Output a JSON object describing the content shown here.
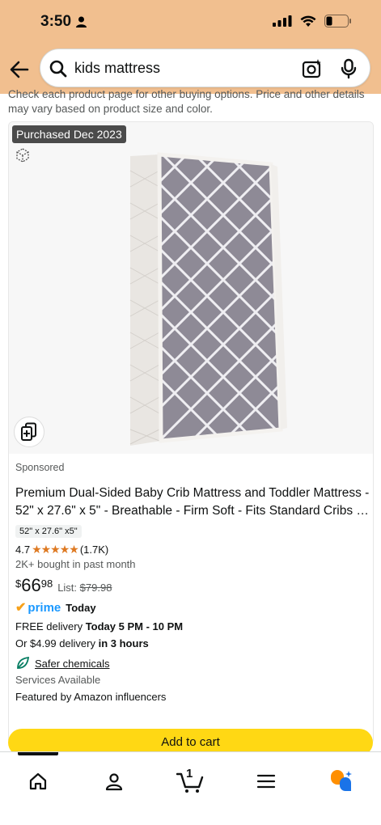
{
  "status_bar": {
    "time": "3:50"
  },
  "search": {
    "query": "kids mattress"
  },
  "disclaimer": "Check each product page for other buying options. Price and other details may vary based on product size and color.",
  "product": {
    "badge": "Purchased Dec 2023",
    "sponsored": "Sponsored",
    "title_line1": "Premium Dual-Sided Baby Crib Mattress and Toddler Mattress -",
    "title_line2": "52\" x 27.6\" x 5\" - Breathable - Firm Soft - Fits Standard Cribs and...",
    "size_chip": "52\" x 27.6\" x5\"",
    "rating": "4.7",
    "stars": "★★★★★",
    "review_count": "(1.7K)",
    "bought": "2K+ bought in past month",
    "price_currency": "$",
    "price_whole": "66",
    "price_fraction": "98",
    "list_label": "List:",
    "list_price": "$79.98",
    "prime_label": "prime",
    "prime_today": "Today",
    "delivery1_prefix": "FREE delivery ",
    "delivery1_bold": "Today 5 PM - 10 PM",
    "delivery2_prefix": "Or $4.99 delivery ",
    "delivery2_bold": "in 3 hours",
    "safer": "Safer chemicals",
    "services": "Services Available",
    "featured": "Featured by Amazon influencers",
    "add_to_cart": "Add to cart"
  },
  "nav": {
    "cart_count": "1"
  },
  "colors": {
    "header": "#f1bf8f",
    "cart_button": "#ffd814",
    "star": "#de7921",
    "prime": "#1a98ff"
  }
}
